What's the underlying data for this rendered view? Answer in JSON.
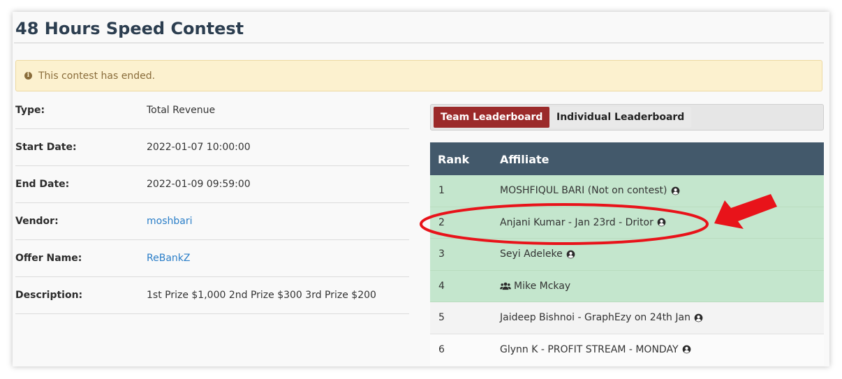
{
  "page": {
    "title": "48 Hours Speed Contest",
    "alert": "This contest has ended."
  },
  "details": [
    {
      "label": "Type:",
      "value": "Total Revenue",
      "is_link": false
    },
    {
      "label": "Start Date:",
      "value": "2022-01-07 10:00:00",
      "is_link": false
    },
    {
      "label": "End Date:",
      "value": "2022-01-09 09:59:00",
      "is_link": false
    },
    {
      "label": "Vendor:",
      "value": "moshbari",
      "is_link": true
    },
    {
      "label": "Offer Name:",
      "value": "ReBankZ",
      "is_link": true
    },
    {
      "label": "Description:",
      "value": "1st Prize $1,000 2nd Prize $300 3rd Prize $200",
      "is_link": false
    }
  ],
  "tabs": {
    "team": "Team Leaderboard",
    "individual": "Individual Leaderboard",
    "active": "team"
  },
  "leaderboard": {
    "columns": {
      "rank": "Rank",
      "affiliate": "Affiliate"
    },
    "rows": [
      {
        "rank": "1",
        "name": "MOSHFIQUL BARI (Not on contest)",
        "icon": "user-circle-icon",
        "icon_position": "after",
        "highlight": "green"
      },
      {
        "rank": "2",
        "name": "Anjani Kumar - Jan 23rd - Dritor",
        "icon": "user-circle-icon",
        "icon_position": "after",
        "highlight": "green"
      },
      {
        "rank": "3",
        "name": "Seyi Adeleke",
        "icon": "user-circle-icon",
        "icon_position": "after",
        "highlight": "green"
      },
      {
        "rank": "4",
        "name": "Mike Mckay",
        "icon": "users-icon",
        "icon_position": "before",
        "highlight": "green"
      },
      {
        "rank": "5",
        "name": "Jaideep Bishnoi - GraphEzy on 24th Jan",
        "icon": "user-circle-icon",
        "icon_position": "after",
        "highlight": "grey"
      },
      {
        "rank": "6",
        "name": "Glynn K - PROFIT STREAM - MONDAY",
        "icon": "user-circle-icon",
        "icon_position": "after",
        "highlight": "white"
      }
    ]
  },
  "colors": {
    "header_bg": "#43596b",
    "active_tab": "#9b2a2a",
    "highlight_row": "#c4e6cd",
    "link": "#2a7ec8",
    "annotation": "#e8131a"
  }
}
